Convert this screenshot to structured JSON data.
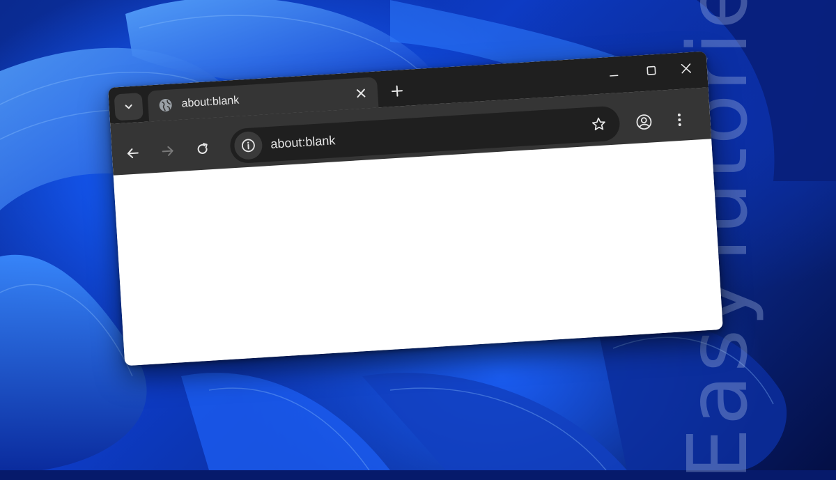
{
  "wallpaper": {
    "name": "windows-11-bloom"
  },
  "watermark": {
    "text": "EasyTutoriel"
  },
  "tabs": [
    {
      "title": "about:blank",
      "favicon": "globe-icon",
      "active": true
    }
  ],
  "omnibox": {
    "url": "about:blank",
    "site_info_icon": "info-icon"
  },
  "icons": {
    "tab_search": "chevron-down-icon",
    "new_tab": "plus-icon",
    "back": "arrow-left-icon",
    "forward": "arrow-right-icon",
    "reload": "reload-icon",
    "bookmark": "star-icon",
    "profile": "profile-icon",
    "menu": "kebab-menu-icon",
    "minimize": "minimize-icon",
    "maximize": "maximize-icon",
    "close": "close-icon"
  },
  "colors": {
    "frame": "#1f1f1f",
    "toolbar": "#353535",
    "omnibox": "#1f1f1f",
    "text": "#e8e8e8",
    "page": "#ffffff"
  }
}
